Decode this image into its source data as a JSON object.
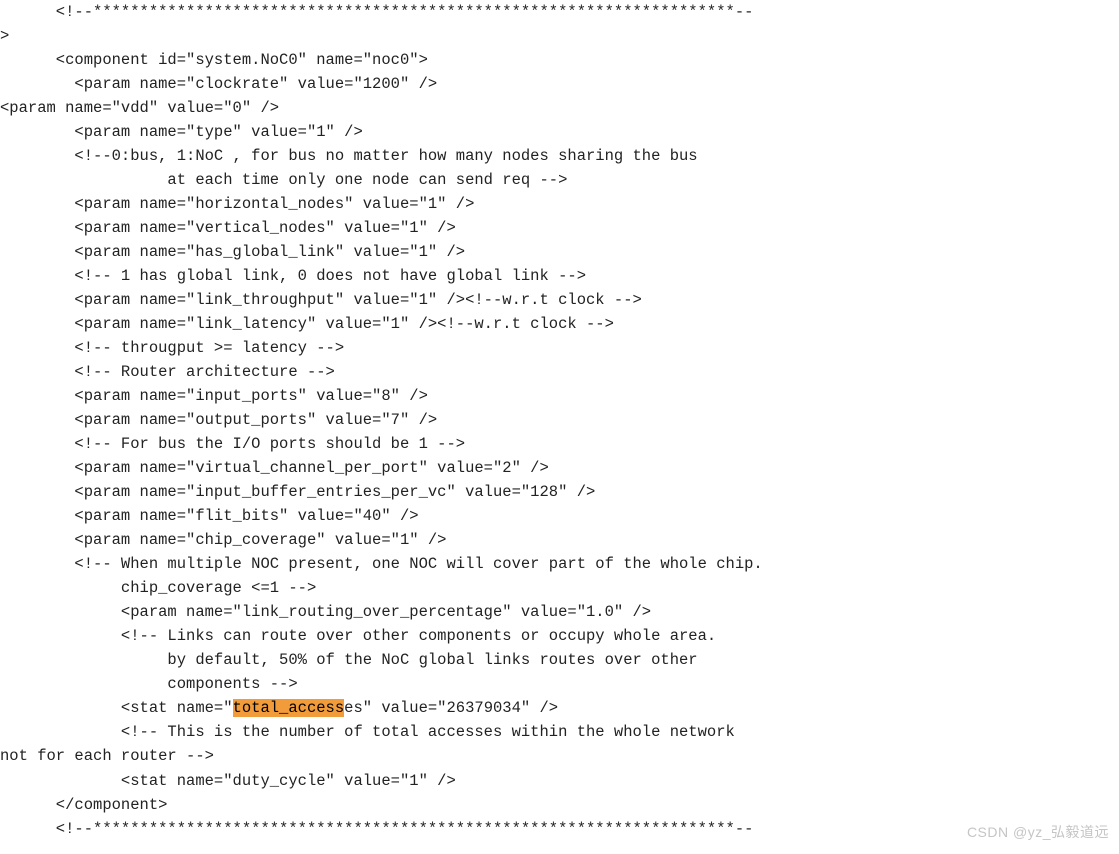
{
  "lines": [
    "      <!--*********************************************************************--",
    ">",
    "      <component id=\"system.NoC0\" name=\"noc0\">",
    "        <param name=\"clockrate\" value=\"1200\" />",
    "<param name=\"vdd\" value=\"0\" />",
    "        <param name=\"type\" value=\"1\" />",
    "        <!--0:bus, 1:NoC , for bus no matter how many nodes sharing the bus",
    "                  at each time only one node can send req -->",
    "        <param name=\"horizontal_nodes\" value=\"1\" />",
    "        <param name=\"vertical_nodes\" value=\"1\" />",
    "        <param name=\"has_global_link\" value=\"1\" />",
    "        <!-- 1 has global link, 0 does not have global link -->",
    "        <param name=\"link_throughput\" value=\"1\" /><!--w.r.t clock -->",
    "        <param name=\"link_latency\" value=\"1\" /><!--w.r.t clock -->",
    "        <!-- througput >= latency -->",
    "        <!-- Router architecture -->",
    "        <param name=\"input_ports\" value=\"8\" />",
    "        <param name=\"output_ports\" value=\"7\" />",
    "        <!-- For bus the I/O ports should be 1 -->",
    "        <param name=\"virtual_channel_per_port\" value=\"2\" />",
    "        <param name=\"input_buffer_entries_per_vc\" value=\"128\" />",
    "        <param name=\"flit_bits\" value=\"40\" />",
    "        <param name=\"chip_coverage\" value=\"1\" />",
    "        <!-- When multiple NOC present, one NOC will cover part of the whole chip.",
    "             chip_coverage <=1 -->",
    "             <param name=\"link_routing_over_percentage\" value=\"1.0\" />",
    "             <!-- Links can route over other components or occupy whole area.",
    "                  by default, 50% of the NoC global links routes over other",
    "                  components -->"
  ],
  "hl_line": {
    "pre": "             <stat name=\"",
    "hl": "total_access",
    "post": "es\" value=\"26379034\" />"
  },
  "lines_after": [
    "             <!-- This is the number of total accesses within the whole network",
    "not for each router -->",
    "             <stat name=\"duty_cycle\" value=\"1\" />",
    "      </component>",
    "      <!--*********************************************************************--"
  ],
  "watermark": "CSDN @yz_弘毅道远"
}
